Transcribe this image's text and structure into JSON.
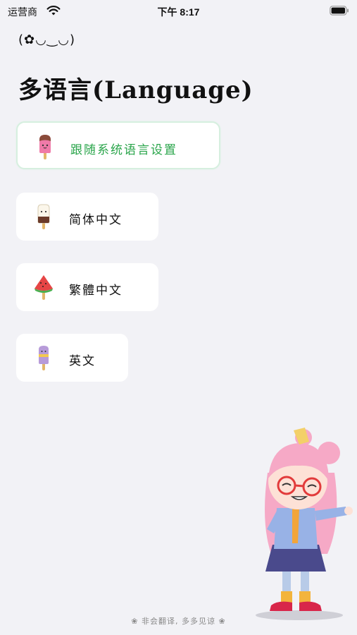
{
  "status_bar": {
    "carrier": "运营商",
    "time": "下午 8:17"
  },
  "header": {
    "kaomoji": "(✿◡‿◡)",
    "title": "多语言(Language)"
  },
  "options": [
    {
      "label": "跟随系统语言设置",
      "icon": "pink-popsicle-icon",
      "selected": true
    },
    {
      "label": "简体中文",
      "icon": "vanilla-chocolate-popsicle-icon",
      "selected": false
    },
    {
      "label": "繁體中文",
      "icon": "watermelon-popsicle-icon",
      "selected": false
    },
    {
      "label": "英文",
      "icon": "purple-popsicle-icon",
      "selected": false
    }
  ],
  "footer": {
    "text": "❀ 非会翻译, 多多见谅 ❀"
  },
  "colors": {
    "background": "#f2f2f6",
    "selected_text": "#2aa54b",
    "selected_border": "#d6efdf"
  }
}
